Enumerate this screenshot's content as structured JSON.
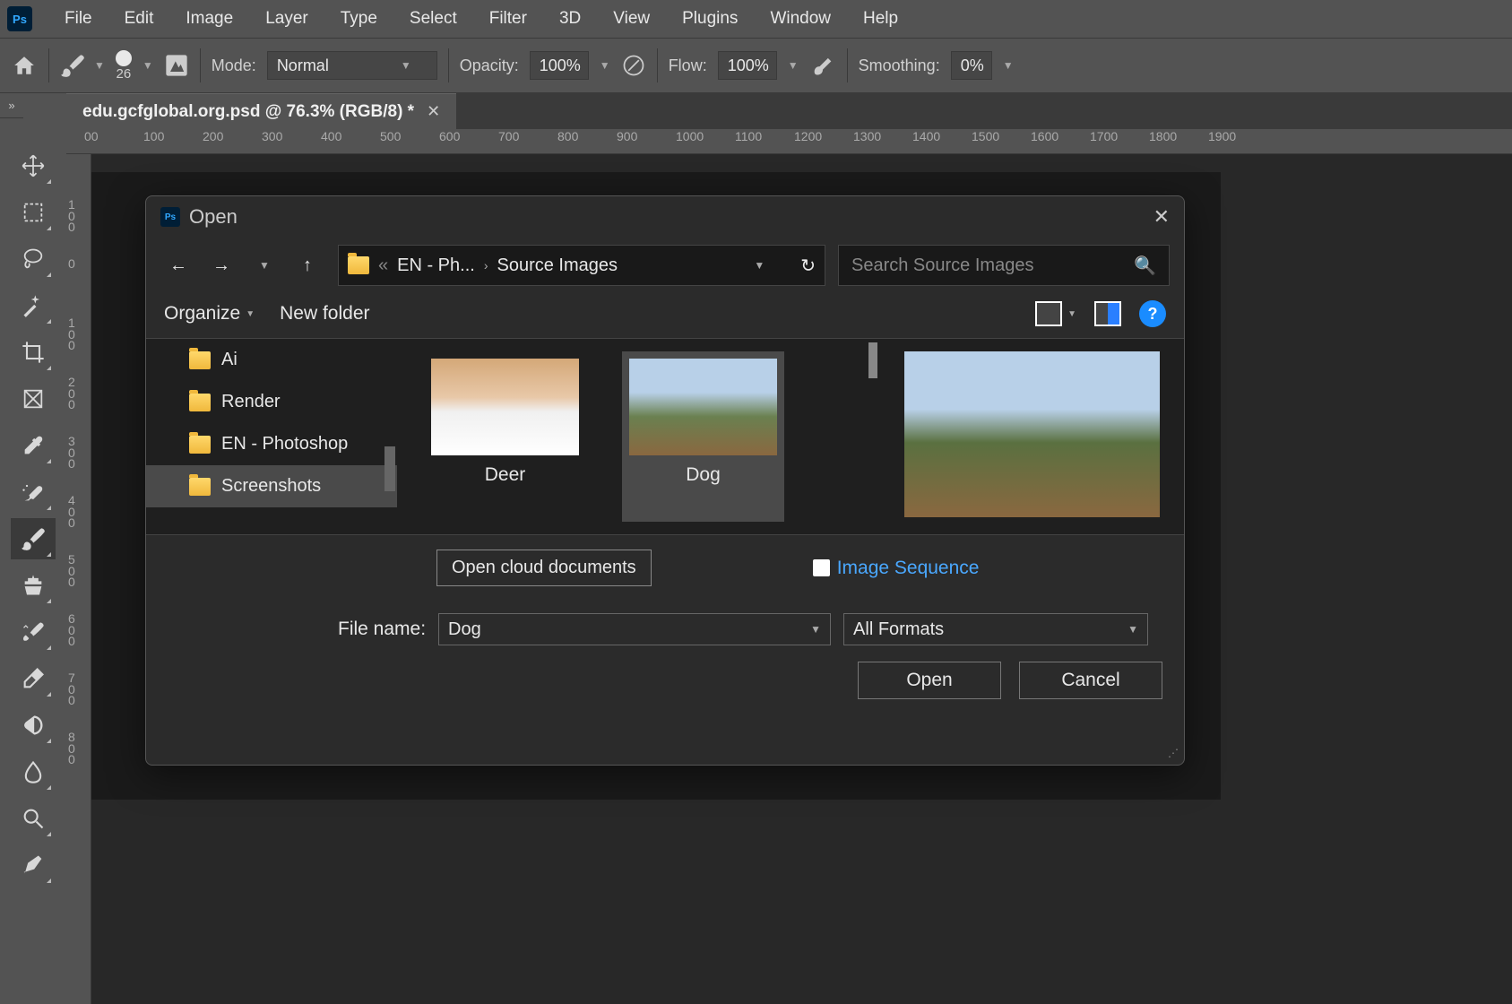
{
  "menubar": [
    "File",
    "Edit",
    "Image",
    "Layer",
    "Type",
    "Select",
    "Filter",
    "3D",
    "View",
    "Plugins",
    "Window",
    "Help"
  ],
  "optionsbar": {
    "brush_size": "26",
    "mode_label": "Mode:",
    "mode_value": "Normal",
    "opacity_label": "Opacity:",
    "opacity_value": "100%",
    "flow_label": "Flow:",
    "flow_value": "100%",
    "smoothing_label": "Smoothing:",
    "smoothing_value": "0%"
  },
  "document": {
    "tab_title": "edu.gcfglobal.org.psd @ 76.3% (RGB/8) *"
  },
  "ruler_h": [
    "00",
    "100",
    "200",
    "300",
    "400",
    "500",
    "600",
    "700",
    "800",
    "900",
    "1000",
    "1100",
    "1200",
    "1300",
    "1400",
    "1500",
    "1600",
    "1700",
    "1800",
    "1900"
  ],
  "ruler_v": [
    "100",
    "0",
    "100",
    "200",
    "300",
    "400",
    "500",
    "600",
    "700",
    "800"
  ],
  "dialog": {
    "title": "Open",
    "breadcrumb": {
      "parent": "EN - Ph...",
      "current": "Source Images",
      "ellipsis": "«"
    },
    "search_placeholder": "Search Source Images",
    "organize": "Organize",
    "new_folder": "New folder",
    "tree": [
      {
        "label": "Ai",
        "selected": false
      },
      {
        "label": "Render",
        "selected": false
      },
      {
        "label": "EN - Photoshop",
        "selected": false
      },
      {
        "label": "Screenshots",
        "selected": true
      }
    ],
    "files": [
      {
        "label": "Deer",
        "selected": false
      },
      {
        "label": "Dog",
        "selected": true
      }
    ],
    "open_cloud": "Open cloud documents",
    "image_sequence": "Image Sequence",
    "filename_label": "File name:",
    "filename_value": "Dog",
    "format_value": "All Formats",
    "open_btn": "Open",
    "cancel_btn": "Cancel"
  }
}
